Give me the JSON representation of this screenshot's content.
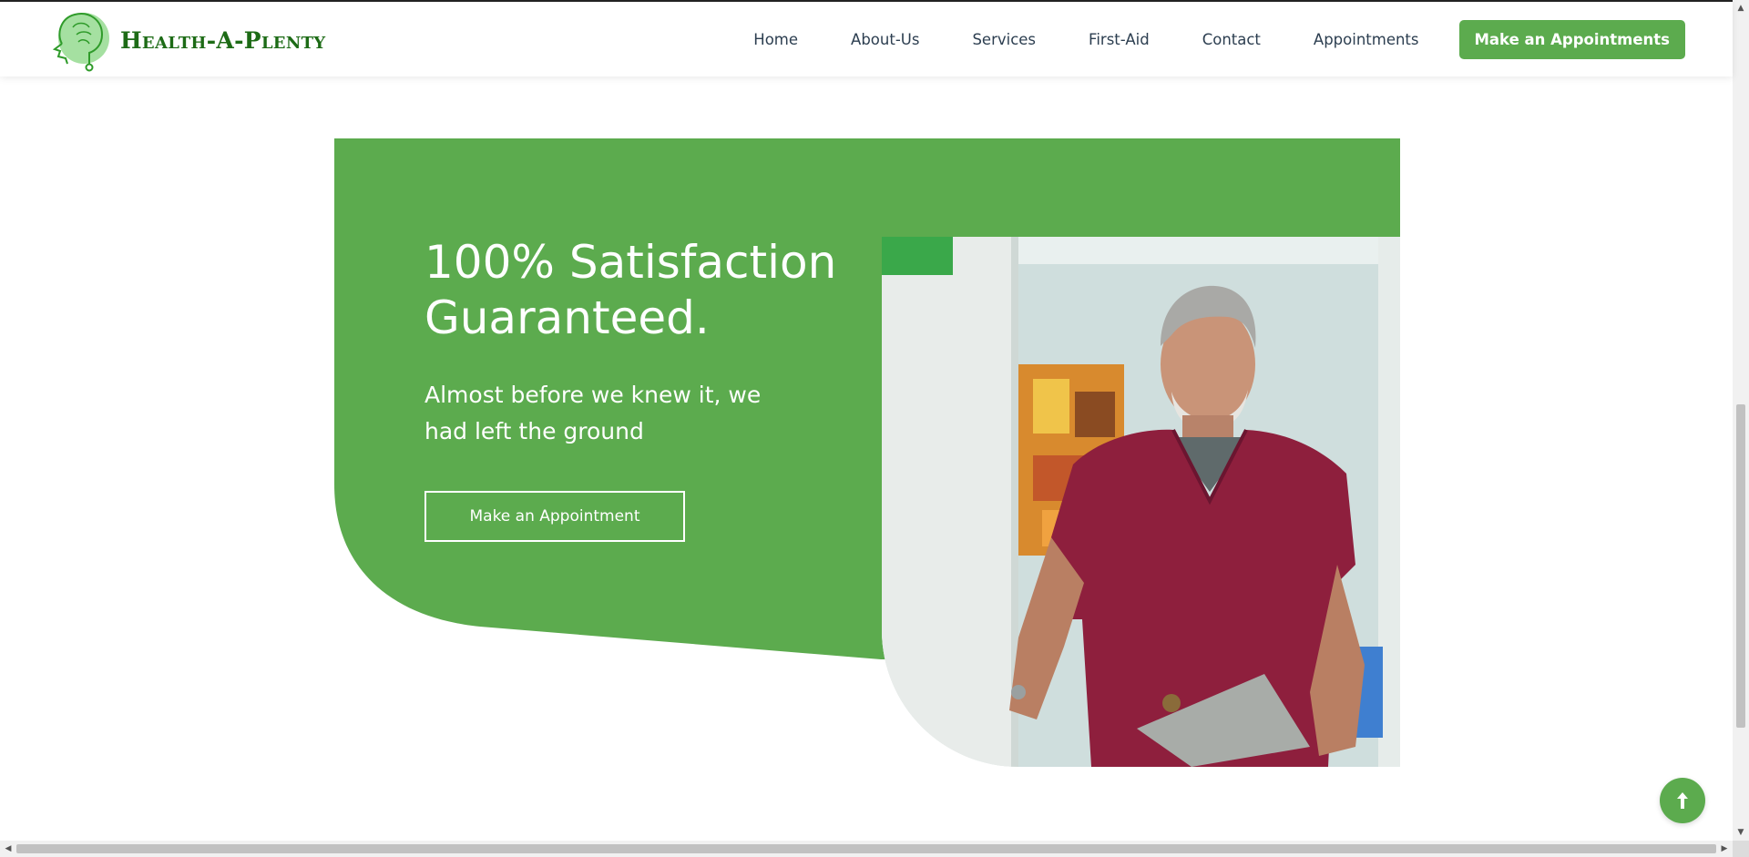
{
  "header": {
    "brand_name": "Health-A-Plenty",
    "logo_icon": "head-brain-stethoscope-icon",
    "nav": [
      {
        "label": "Home"
      },
      {
        "label": "About-Us"
      },
      {
        "label": "Services"
      },
      {
        "label": "First-Aid"
      },
      {
        "label": "Contact"
      },
      {
        "label": "Appointments"
      }
    ],
    "cta_label": "Make an Appointments"
  },
  "hero": {
    "title": "100% Satisfaction Guaranteed.",
    "subtitle": "Almost before we knew it, we had left the ground",
    "button_label": "Make an Appointment",
    "image_icon": "doctor-photo"
  },
  "back_to_top_icon": "arrow-up-icon",
  "colors": {
    "brand_green": "#5cab4e",
    "logo_green": "#1d6b16",
    "nav_text": "#2c3e50",
    "background": "#ffffff"
  }
}
